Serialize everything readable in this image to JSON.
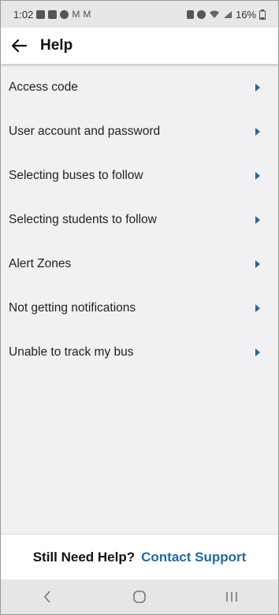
{
  "status_bar": {
    "time": "1:02",
    "battery": "16%"
  },
  "header": {
    "title": "Help"
  },
  "help_topics": [
    {
      "label": "Access code"
    },
    {
      "label": "User account and password"
    },
    {
      "label": "Selecting buses to follow"
    },
    {
      "label": "Selecting students to follow"
    },
    {
      "label": "Alert Zones"
    },
    {
      "label": "Not getting notifications"
    },
    {
      "label": "Unable to track my bus"
    }
  ],
  "footer": {
    "prompt": "Still Need Help?",
    "link": "Contact Support"
  },
  "colors": {
    "accent": "#1f6aa6",
    "chevron": "#1f6aa6",
    "background": "#f1f1f3"
  }
}
